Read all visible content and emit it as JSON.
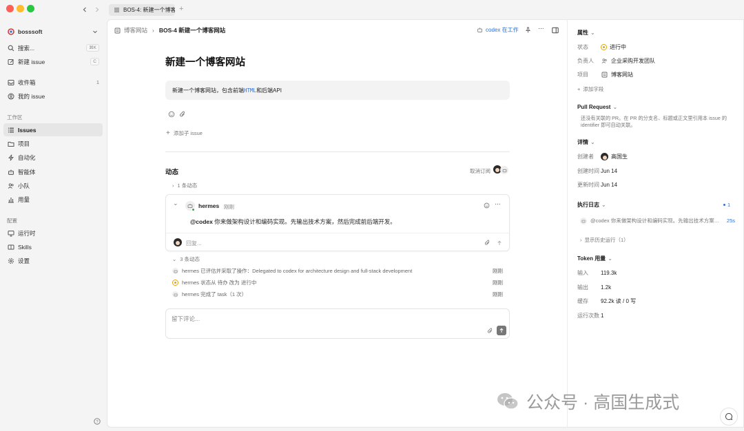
{
  "titlebar": {
    "tab_label": "BOS-4: 新建一个博客网"
  },
  "sidebar": {
    "workspace_name": "bosssoft",
    "search_label": "搜索...",
    "search_shortcut": "⌘K",
    "new_issue_label": "新建 issue",
    "new_issue_shortcut": "C",
    "inbox_label": "收件箱",
    "inbox_count": "1",
    "my_issues_label": "我的 issue",
    "section_workspace": "工作区",
    "items": [
      {
        "label": "Issues",
        "icon": "list-icon"
      },
      {
        "label": "项目",
        "icon": "folder-icon"
      },
      {
        "label": "自动化",
        "icon": "bolt-icon"
      },
      {
        "label": "智能体",
        "icon": "robot-icon"
      },
      {
        "label": "小队",
        "icon": "team-icon"
      },
      {
        "label": "用量",
        "icon": "bar-chart-icon"
      }
    ],
    "section_settings": "配置",
    "settings_items": [
      {
        "label": "运行时",
        "icon": "monitor-icon"
      },
      {
        "label": "Skills",
        "icon": "book-icon"
      },
      {
        "label": "设置",
        "icon": "gear-icon"
      }
    ]
  },
  "topbar": {
    "breadcrumb_project": "博客网站",
    "breadcrumb_issue": "BOS-4 新建一个博客网站",
    "agent_status": "codex 在工作"
  },
  "issue": {
    "title": "新建一个博客网站",
    "description_prefix": "新建一个博客网站，包含前端",
    "description_code": "HTML",
    "description_suffix": "和后端API",
    "add_sub_issue": "添加子 issue"
  },
  "activity": {
    "heading": "动态",
    "unsubscribe": "取消订阅",
    "collapsed_count_1": "1 条动态",
    "comment": {
      "author": "hermes",
      "time": "刚刚",
      "mention": "@codex",
      "body": " 你来做架构设计和编码实现。先输出技术方案，然后完成前后端开发。",
      "reply_placeholder": "回复..."
    },
    "collapsed_count_3": "3 条动态",
    "events": [
      {
        "text": "hermes 已评估并采取了操作：Delegated to codex for architecture design and full-stack development",
        "time": "刚刚",
        "icon": "bot-icon"
      },
      {
        "text": "hermes 状态从 待办 改为 进行中",
        "time": "刚刚",
        "icon": "in-progress-icon"
      },
      {
        "text": "hermes 完成了 task（1 次）",
        "time": "刚刚",
        "icon": "bot-icon"
      }
    ],
    "comment_placeholder": "留下评论..."
  },
  "panel": {
    "properties_title": "属性",
    "status_label": "状态",
    "status_value": "进行中",
    "assignee_label": "负责人",
    "assignee_value": "企业采购开发团队",
    "project_label": "项目",
    "project_value": "博客网站",
    "add_field": "添加字段",
    "pr_title": "Pull Request",
    "pr_hint": "还没有关联的 PR。在 PR 的分支名、标题或正文里引用本 issue 的 identifier 即可自动关联。",
    "details_title": "详情",
    "creator_label": "创建者",
    "creator_value": "高国生",
    "created_label": "创建时间",
    "created_value": "Jun 14",
    "updated_label": "更新时间",
    "updated_value": "Jun 14",
    "log_title": "执行日志",
    "log_count": "1",
    "log_text": "@codex 你来做架构设计和编码实现。先输出技术方案，...",
    "log_time": "25s",
    "show_history": "显示历史运行（1）",
    "token_title": "Token 用量",
    "input_label": "输入",
    "input_value": "119.3k",
    "output_label": "输出",
    "output_value": "1.2k",
    "cache_label": "缓存",
    "cache_value": "92.2k 读 / 0 写",
    "runs_label": "运行次数",
    "runs_value": "1"
  },
  "watermark": "公众号 · 高国生成式",
  "colors": {
    "accent_blue": "#2f6fd6",
    "status_yellow": "#e0a800",
    "online_green": "#22b14c"
  }
}
